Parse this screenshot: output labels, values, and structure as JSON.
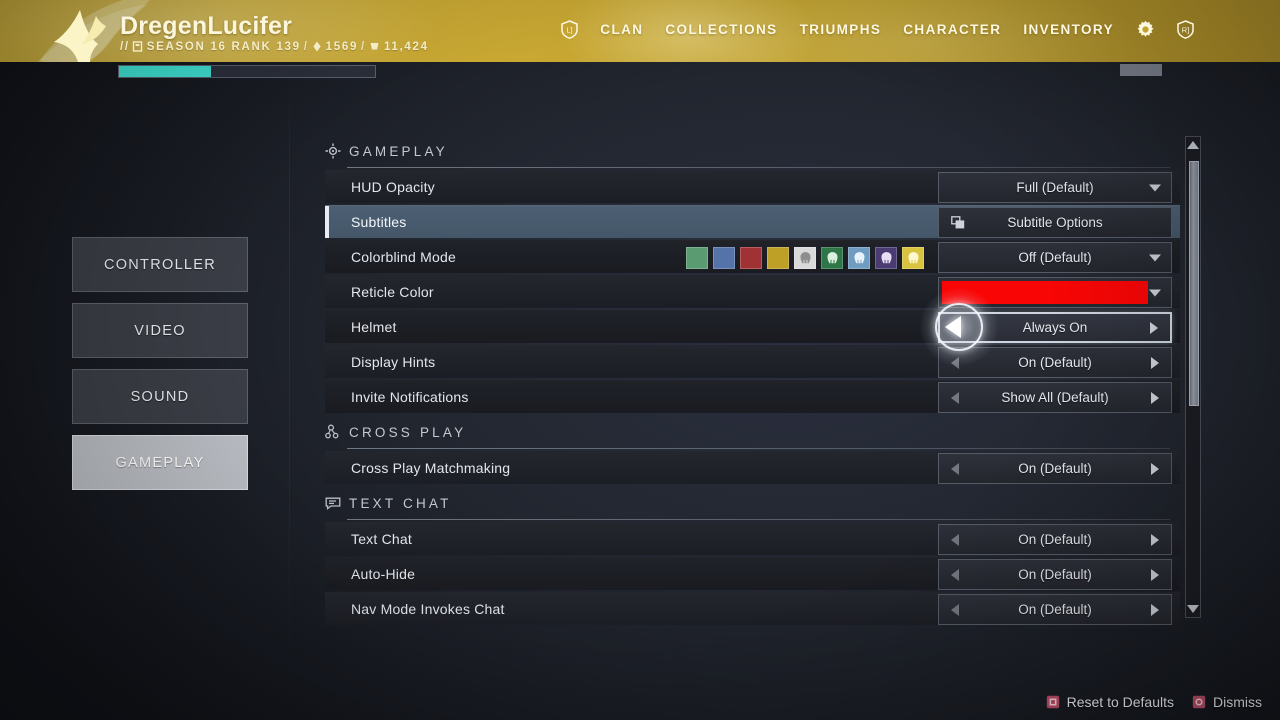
{
  "banner": {
    "player_name": "DregenLucifer",
    "prefix": "//",
    "season_text": "SEASON 16 RANK 139",
    "glimmer": "1569",
    "legendary_shards": "11,424",
    "sep": "/",
    "season_icon": "season-pass-icon",
    "glimmer_icon": "glimmer-icon",
    "shards_icon": "legendary-shard-icon",
    "emblem_icon": "guardian-emblem-wing-icon",
    "accent_color": "#c8a732"
  },
  "topnav": {
    "clan_badge_icon": "clan-badge-icon",
    "items": [
      {
        "label": "CLAN",
        "name": "nav-clan"
      },
      {
        "label": "COLLECTIONS",
        "name": "nav-collections"
      },
      {
        "label": "TRIUMPHS",
        "name": "nav-triumphs"
      },
      {
        "label": "CHARACTER",
        "name": "nav-character"
      },
      {
        "label": "INVENTORY",
        "name": "nav-inventory"
      }
    ],
    "settings_icon": "gear-icon",
    "roster_icon": "roster-badge-icon"
  },
  "xp_bar": {
    "fill_percent": 36,
    "fill_color": "#3fe0d2"
  },
  "tabs": [
    {
      "label": "CONTROLLER",
      "name": "tab-controller",
      "active": false
    },
    {
      "label": "VIDEO",
      "name": "tab-video",
      "active": false
    },
    {
      "label": "SOUND",
      "name": "tab-sound",
      "active": false
    },
    {
      "label": "GAMEPLAY",
      "name": "tab-gameplay",
      "active": true
    }
  ],
  "sections": {
    "gameplay": {
      "title": "GAMEPLAY",
      "icon": "reticle-icon"
    },
    "crossplay": {
      "title": "CROSS PLAY",
      "icon": "crossplay-nodes-icon"
    },
    "textchat": {
      "title": "TEXT CHAT",
      "icon": "speech-bubble-icon"
    }
  },
  "settings": {
    "hud_opacity": {
      "label": "HUD Opacity",
      "value": "Full (Default)",
      "control": "dropdown"
    },
    "subtitles": {
      "label": "Subtitles",
      "value": "Subtitle Options",
      "control": "button",
      "selected": true,
      "icon": "subtitle-options-icon"
    },
    "colorblind": {
      "label": "Colorblind Mode",
      "value": "Off (Default)",
      "control": "dropdown"
    },
    "reticle_color": {
      "label": "Reticle Color",
      "value": "",
      "control": "color",
      "color": "#fa0505"
    },
    "helmet": {
      "label": "Helmet",
      "value": "Always On",
      "control": "stepper",
      "highlighted": true
    },
    "display_hints": {
      "label": "Display Hints",
      "value": "On (Default)",
      "control": "stepper"
    },
    "invite_notifications": {
      "label": "Invite Notifications",
      "value": "Show All (Default)",
      "control": "stepper"
    },
    "cross_play_matchmaking": {
      "label": "Cross Play Matchmaking",
      "value": "On (Default)",
      "control": "stepper"
    },
    "text_chat": {
      "label": "Text Chat",
      "value": "On (Default)",
      "control": "stepper"
    },
    "auto_hide": {
      "label": "Auto-Hide",
      "value": "On (Default)",
      "control": "stepper"
    },
    "nav_mode_invokes_chat": {
      "label": "Nav Mode Invokes Chat",
      "value": "On (Default)",
      "control": "stepper"
    }
  },
  "colorblind_swatches": [
    {
      "name": "swatch-green",
      "color": "#5a9b72",
      "glyph": false
    },
    {
      "name": "swatch-blue",
      "color": "#5573a8",
      "glyph": false
    },
    {
      "name": "swatch-red",
      "color": "#a03235",
      "glyph": false
    },
    {
      "name": "swatch-gold",
      "color": "#bfa027",
      "glyph": false
    },
    {
      "name": "swatch-helmet-white",
      "color": "#d9d9d9",
      "glyph": true,
      "glyph_color": "#8d8d8d"
    },
    {
      "name": "swatch-helmet-green",
      "color": "#2e7547",
      "glyph": true,
      "glyph_color": "#d8f0dd"
    },
    {
      "name": "swatch-helmet-blue",
      "color": "#6f9cc0",
      "glyph": true,
      "glyph_color": "#e7f2fa"
    },
    {
      "name": "swatch-helmet-purple",
      "color": "#4a3c72",
      "glyph": true,
      "glyph_color": "#e8dff7"
    },
    {
      "name": "swatch-helmet-yellow",
      "color": "#d9c33f",
      "glyph": true,
      "glyph_color": "#fdf8d2"
    }
  ],
  "scrollbar": {
    "up_icon": "scroll-up-arrow-icon",
    "down_icon": "scroll-down-arrow-icon",
    "thumb_top_pct": 5,
    "thumb_height_pct": 51
  },
  "footer": [
    {
      "label": "Reset to Defaults",
      "name": "reset-to-defaults-button",
      "glyph": "square-button-icon",
      "color": "#d8516f"
    },
    {
      "label": "Dismiss",
      "name": "dismiss-button",
      "glyph": "circle-button-icon",
      "color": "#d8516f"
    }
  ],
  "cursor": {
    "name": "selection-cursor",
    "direction": "left"
  }
}
